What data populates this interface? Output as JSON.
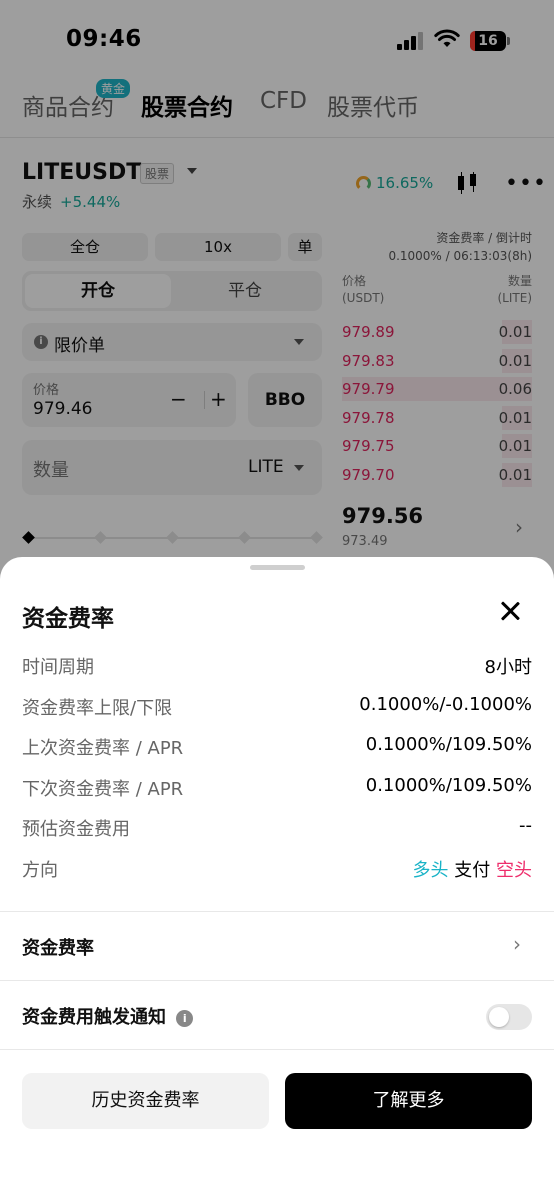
{
  "status_bar": {
    "time": "09:46",
    "battery": "16"
  },
  "category_tabs": [
    {
      "label": "商品合约",
      "badge": "黄金"
    },
    {
      "label": "股票合约",
      "active": true
    },
    {
      "label": "CFD"
    },
    {
      "label": "股票代币"
    }
  ],
  "symbol": {
    "name": "LITEUSDT",
    "tag": "股票",
    "type": "永续",
    "change": "+5.44%",
    "rate_percent": "16.65%"
  },
  "order_form": {
    "margin_mode": "全仓",
    "leverage": "10x",
    "position_mode": "单",
    "open_tab": "开仓",
    "close_tab": "平仓",
    "order_type": "限价单",
    "price_label": "价格",
    "price_value": "979.46",
    "minus": "−",
    "plus": "+",
    "bbo": "BBO",
    "qty_placeholder": "数量",
    "qty_unit": "LITE"
  },
  "funding_header": {
    "label": "资金费率 / 倒计时",
    "value": "0.1000% / 06:13:03(8h)"
  },
  "orderbook": {
    "price_header": [
      "价格",
      "(USDT)"
    ],
    "qty_header": [
      "数量",
      "(LITE)"
    ],
    "asks": [
      {
        "price": "979.89",
        "qty": "0.01",
        "depth": 0.16
      },
      {
        "price": "979.83",
        "qty": "0.01",
        "depth": 0.16
      },
      {
        "price": "979.79",
        "qty": "0.06",
        "depth": 1.0
      },
      {
        "price": "979.78",
        "qty": "0.01",
        "depth": 0.16
      },
      {
        "price": "979.75",
        "qty": "0.01",
        "depth": 0.16
      },
      {
        "price": "979.70",
        "qty": "0.01",
        "depth": 0.16
      }
    ],
    "last_price": "979.56",
    "mark_price": "973.49"
  },
  "sheet": {
    "title": "资金费率",
    "rows": [
      {
        "key": "时间周期",
        "value": "8小时"
      },
      {
        "key": "资金费率上限/下限",
        "value": "0.1000%/-0.1000%"
      },
      {
        "key": "上次资金费率 / APR",
        "value": "0.1000%/109.50%"
      },
      {
        "key": "下次资金费率 / APR",
        "value": "0.1000%/109.50%"
      },
      {
        "key": "预估资金费用",
        "value": "--"
      }
    ],
    "direction": {
      "key": "方向",
      "long": "多头",
      "pay": "支付",
      "short": "空头"
    },
    "funding_rate_link": "资金费率",
    "notify_label": "资金费用触发通知",
    "notify_enabled": false,
    "history_button": "历史资金费率",
    "learn_more_button": "了解更多",
    "colors": {
      "long": "#1ab3c7",
      "short": "#ee2d6b",
      "primary": "#000000"
    }
  }
}
